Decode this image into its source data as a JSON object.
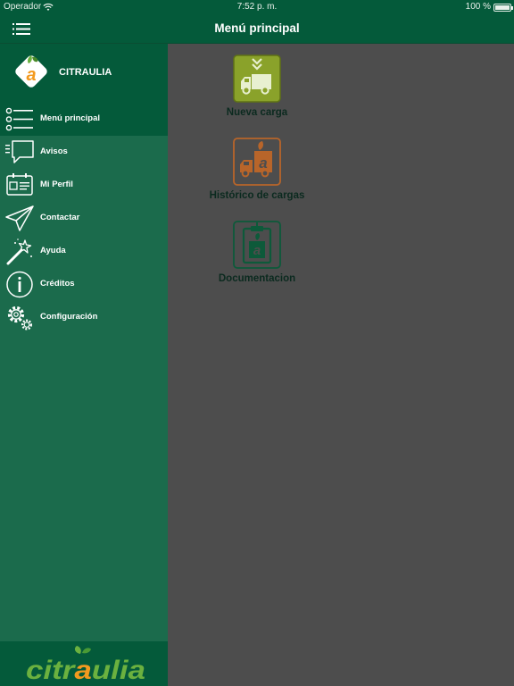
{
  "status_bar": {
    "carrier": "Operador",
    "time": "7:52 p. m.",
    "battery": "100 %",
    "battery_level": 1.0
  },
  "navbar": {
    "title": "Menú principal",
    "menu_icon": "hamburger-icon"
  },
  "sidebar": {
    "brand_name": "CITRAULIA",
    "items": [
      {
        "label": "Menú principal",
        "icon": "list-icon",
        "active": true
      },
      {
        "label": "Avisos",
        "icon": "speech-bubble-icon",
        "active": false
      },
      {
        "label": "Mi Perfil",
        "icon": "id-card-icon",
        "active": false
      },
      {
        "label": "Contactar",
        "icon": "paper-plane-icon",
        "active": false
      },
      {
        "label": "Ayuda",
        "icon": "magic-wand-icon",
        "active": false
      },
      {
        "label": "Créditos",
        "icon": "info-icon",
        "active": false
      },
      {
        "label": "Configuración",
        "icon": "gears-icon",
        "active": false
      }
    ],
    "footer_logo_text": "citraulia"
  },
  "main": {
    "tiles": [
      {
        "label": "Nueva carga",
        "icon": "truck-download-icon",
        "color": "#8aa22a"
      },
      {
        "label": "Histórico de cargas",
        "icon": "truck-history-icon",
        "color": "#b8652a"
      },
      {
        "label": "Documentacion",
        "icon": "clipboard-icon",
        "color": "#0d5a3a"
      }
    ]
  },
  "colors": {
    "primary_dark": "#045a3a",
    "sidebar": "#1b6b4c",
    "content_bg": "#4d4d4d",
    "brand_orange": "#f39a1f",
    "brand_green": "#6bb13f"
  }
}
